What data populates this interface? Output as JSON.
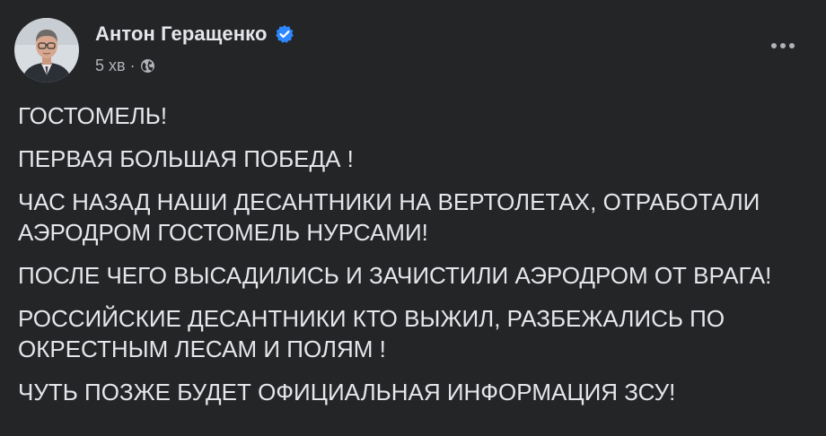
{
  "post": {
    "author": "Антон Геращенко",
    "verified": true,
    "time": "5 хв",
    "separator": "·",
    "audience_icon": "globe-icon",
    "menu_icon": "more-options-icon",
    "paragraphs": [
      "ГОСТОМЕЛЬ!",
      "ПЕРВАЯ БОЛЬШАЯ ПОБЕДА !",
      "ЧАС НАЗАД НАШИ ДЕСАНТНИКИ НА ВЕРТОЛЕТАХ, ОТРАБОТАЛИ\nАЭРОДРОМ ГОСТОМЕЛЬ НУРСАМИ!",
      "ПОСЛЕ ЧЕГО ВЫСАДИЛИСЬ И ЗАЧИСТИЛИ АЭРОДРОМ ОТ ВРАГА!",
      "РОССИЙСКИЕ ДЕСАНТНИКИ КТО ВЫЖИЛ, РАЗБЕЖАЛИСЬ ПО\nОКРЕСТНЫМ ЛЕСАМ И ПОЛЯМ !",
      "ЧУТЬ ПОЗЖЕ БУДЕТ ОФИЦИАЛЬНАЯ ИНФОРМАЦИЯ ЗСУ!"
    ]
  },
  "colors": {
    "background": "#242526",
    "primary_text": "#e4e6eb",
    "secondary_text": "#b0b3b8",
    "verified_badge": "#2d88ff"
  }
}
